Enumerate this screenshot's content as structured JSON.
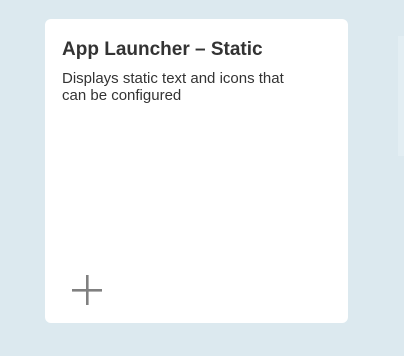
{
  "tile": {
    "title": "App Launcher – Static",
    "description": "Displays static text and icons that can be configured",
    "add_icon": "plus-icon"
  },
  "colors": {
    "background": "#dce9ef",
    "card": "#ffffff",
    "text": "#333333",
    "icon": "#808080"
  }
}
